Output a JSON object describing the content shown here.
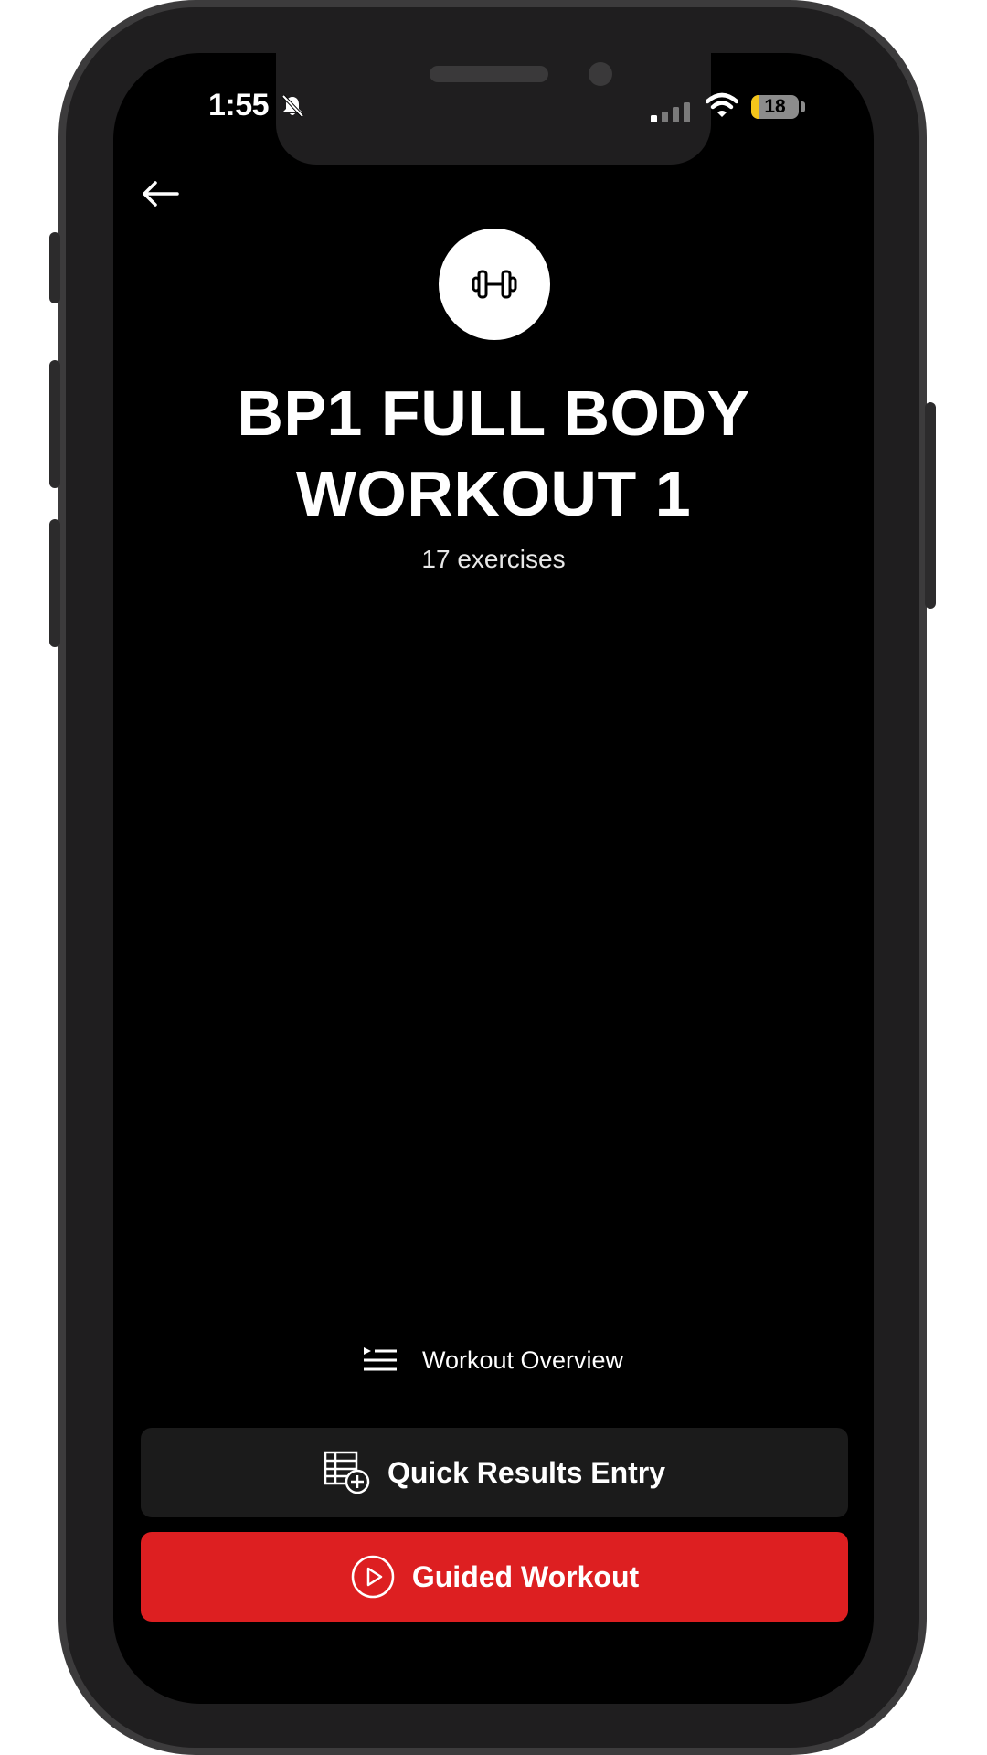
{
  "status_bar": {
    "time": "1:55",
    "battery_level": "18",
    "battery_fraction": 0.18,
    "silent_icon": "bell-slash-icon",
    "signal_icon": "cellular-signal-icon",
    "wifi_icon": "wifi-icon"
  },
  "header": {
    "back_icon": "arrow-left-icon",
    "workout_icon": "dumbbell-icon",
    "title": "BP1 FULL BODY WORKOUT 1",
    "exercise_count": "17 exercises"
  },
  "actions": {
    "overview_label": "Workout Overview",
    "overview_icon": "play-list-icon",
    "quick_results_label": "Quick Results Entry",
    "quick_results_icon": "table-add-icon",
    "guided_label": "Guided Workout",
    "guided_icon": "play-circle-icon"
  },
  "colors": {
    "background": "#000000",
    "primary_button": "#dd1f21",
    "secondary_button": "#1b1b1b",
    "battery_low": "#f4c51a"
  }
}
